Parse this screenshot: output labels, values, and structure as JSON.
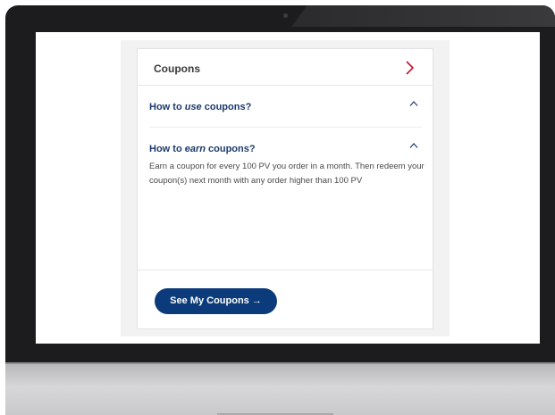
{
  "card": {
    "title": "Coupons"
  },
  "faq": [
    {
      "prefix": "How to ",
      "emphasis": "use",
      "suffix": " coupons?"
    },
    {
      "prefix": "How to ",
      "emphasis": "earn",
      "suffix": " coupons?"
    }
  ],
  "answer_text": "Earn a coupon for every 100 PV you order in a month. Then redeem your coupon(s) next month with any order higher than 100 PV",
  "cta": {
    "label": "See My Coupons →"
  },
  "colors": {
    "brand_navy": "#0b3b7a",
    "accent_red": "#c8102e"
  },
  "icons": {
    "header_action": "chevron-right-icon",
    "faq_toggle": "chevron-up-icon"
  }
}
